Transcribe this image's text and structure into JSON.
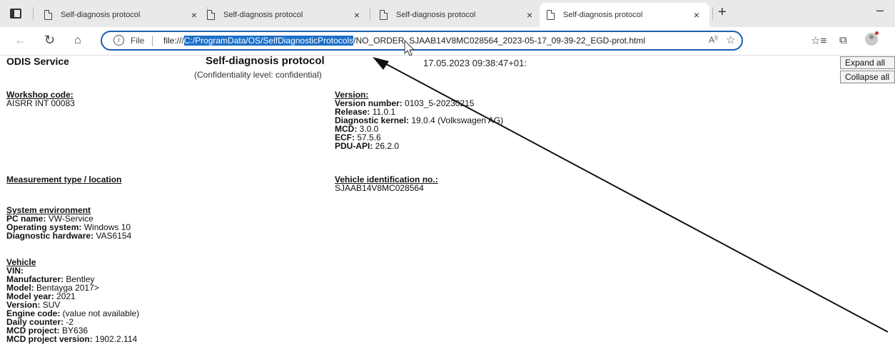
{
  "browser": {
    "tabs": [
      {
        "title": "Self-diagnosis protocol",
        "close": "×",
        "active": false
      },
      {
        "title": "Self-diagnosis protocol",
        "close": "×",
        "active": false
      },
      {
        "title": "Self-diagnosis protocol",
        "close": "×",
        "active": false
      },
      {
        "title": "Self-diagnosis protocol",
        "close": "×",
        "active": true
      }
    ],
    "new_tab_label": "+",
    "minimize_label": "–",
    "address": {
      "scheme_label": "File",
      "url_prefix": "file:///",
      "url_selected": "C:/ProgramData/OS/SelfDiagnosticProtocols",
      "url_rest": "/NO_ORDER_SJAAB14V8MC028564_2023-05-17_09-39-22_EGD-prot.html"
    }
  },
  "page": {
    "app_name": "ODIS Service",
    "title": "Self-diagnosis protocol",
    "subtitle": "(Confidentiality level: confidential)",
    "datetime": "17.05.2023 09:38:47+01:",
    "expand_all": "Expand all",
    "collapse_all": "Collapse all",
    "workshop": {
      "heading": "Workshop code:",
      "value": "AISRR INT 00083"
    },
    "version": {
      "heading": "Version:",
      "lines": [
        {
          "label": "Version number:",
          "value": " 0103_5-20230215"
        },
        {
          "label": "Release:",
          "value": " 11.0.1"
        },
        {
          "label": "Diagnostic kernel:",
          "value": " 19.0.4 (Volkswagen AG)"
        },
        {
          "label": "MCD:",
          "value": " 3.0.0"
        },
        {
          "label": "ECF:",
          "value": " 57.5.6"
        },
        {
          "label": "PDU-API:",
          "value": " 26.2.0"
        }
      ]
    },
    "measurement": {
      "heading": "Measurement type / location"
    },
    "vin_block": {
      "heading": "Vehicle identification no.:",
      "value": "SJAAB14V8MC028564"
    },
    "system_env": {
      "heading": "System environment",
      "lines": [
        {
          "label": "PC name:",
          "value": " VW-Service"
        },
        {
          "label": "Operating system:",
          "value": " Windows 10"
        },
        {
          "label": "Diagnostic hardware:",
          "value": " VAS6154"
        }
      ]
    },
    "vehicle": {
      "heading": "Vehicle",
      "lines": [
        {
          "label": "VIN:",
          "value": ""
        },
        {
          "label": "Manufacturer:",
          "value": " Bentley"
        },
        {
          "label": "Model:",
          "value": " Bentayga 2017>"
        },
        {
          "label": "Model year:",
          "value": " 2021"
        },
        {
          "label": "Version:",
          "value": " SUV"
        },
        {
          "label": "Engine code:",
          "value": " (value not available)"
        },
        {
          "label": "Daily counter:",
          "value": " -2"
        },
        {
          "label": "MCD project:",
          "value": " BY636"
        },
        {
          "label": "MCD project version:",
          "value": " 1902.2.114"
        }
      ]
    }
  }
}
